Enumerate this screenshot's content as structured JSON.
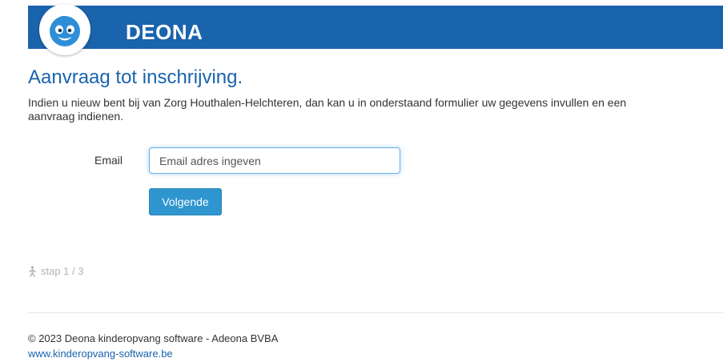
{
  "brand": {
    "name": "DEONA",
    "logo_icon": "smiling-blue-face-icon"
  },
  "page": {
    "title": "Aanvraag tot inschrijving.",
    "intro": "Indien u nieuw bent bij van Zorg Houthalen-Helchteren, dan kan u in onderstaand formulier uw gegevens invullen en een aanvraag indienen."
  },
  "form": {
    "email_label": "Email",
    "email_placeholder": "Email adres ingeven",
    "email_value": "",
    "next_label": "Volgende"
  },
  "progress": {
    "text": "stap 1 / 3",
    "icon": "walking-person-icon",
    "current": 1,
    "total": 3
  },
  "footer": {
    "copyright": "© 2023 Deona kinderopvang software - Adeona BVBA",
    "link": "www.kinderopvang-software.be"
  },
  "colors": {
    "header_bg": "#1a63ad",
    "title": "#1a63ad",
    "button_bg": "#2f95cf",
    "input_focus": "#66afe9"
  }
}
